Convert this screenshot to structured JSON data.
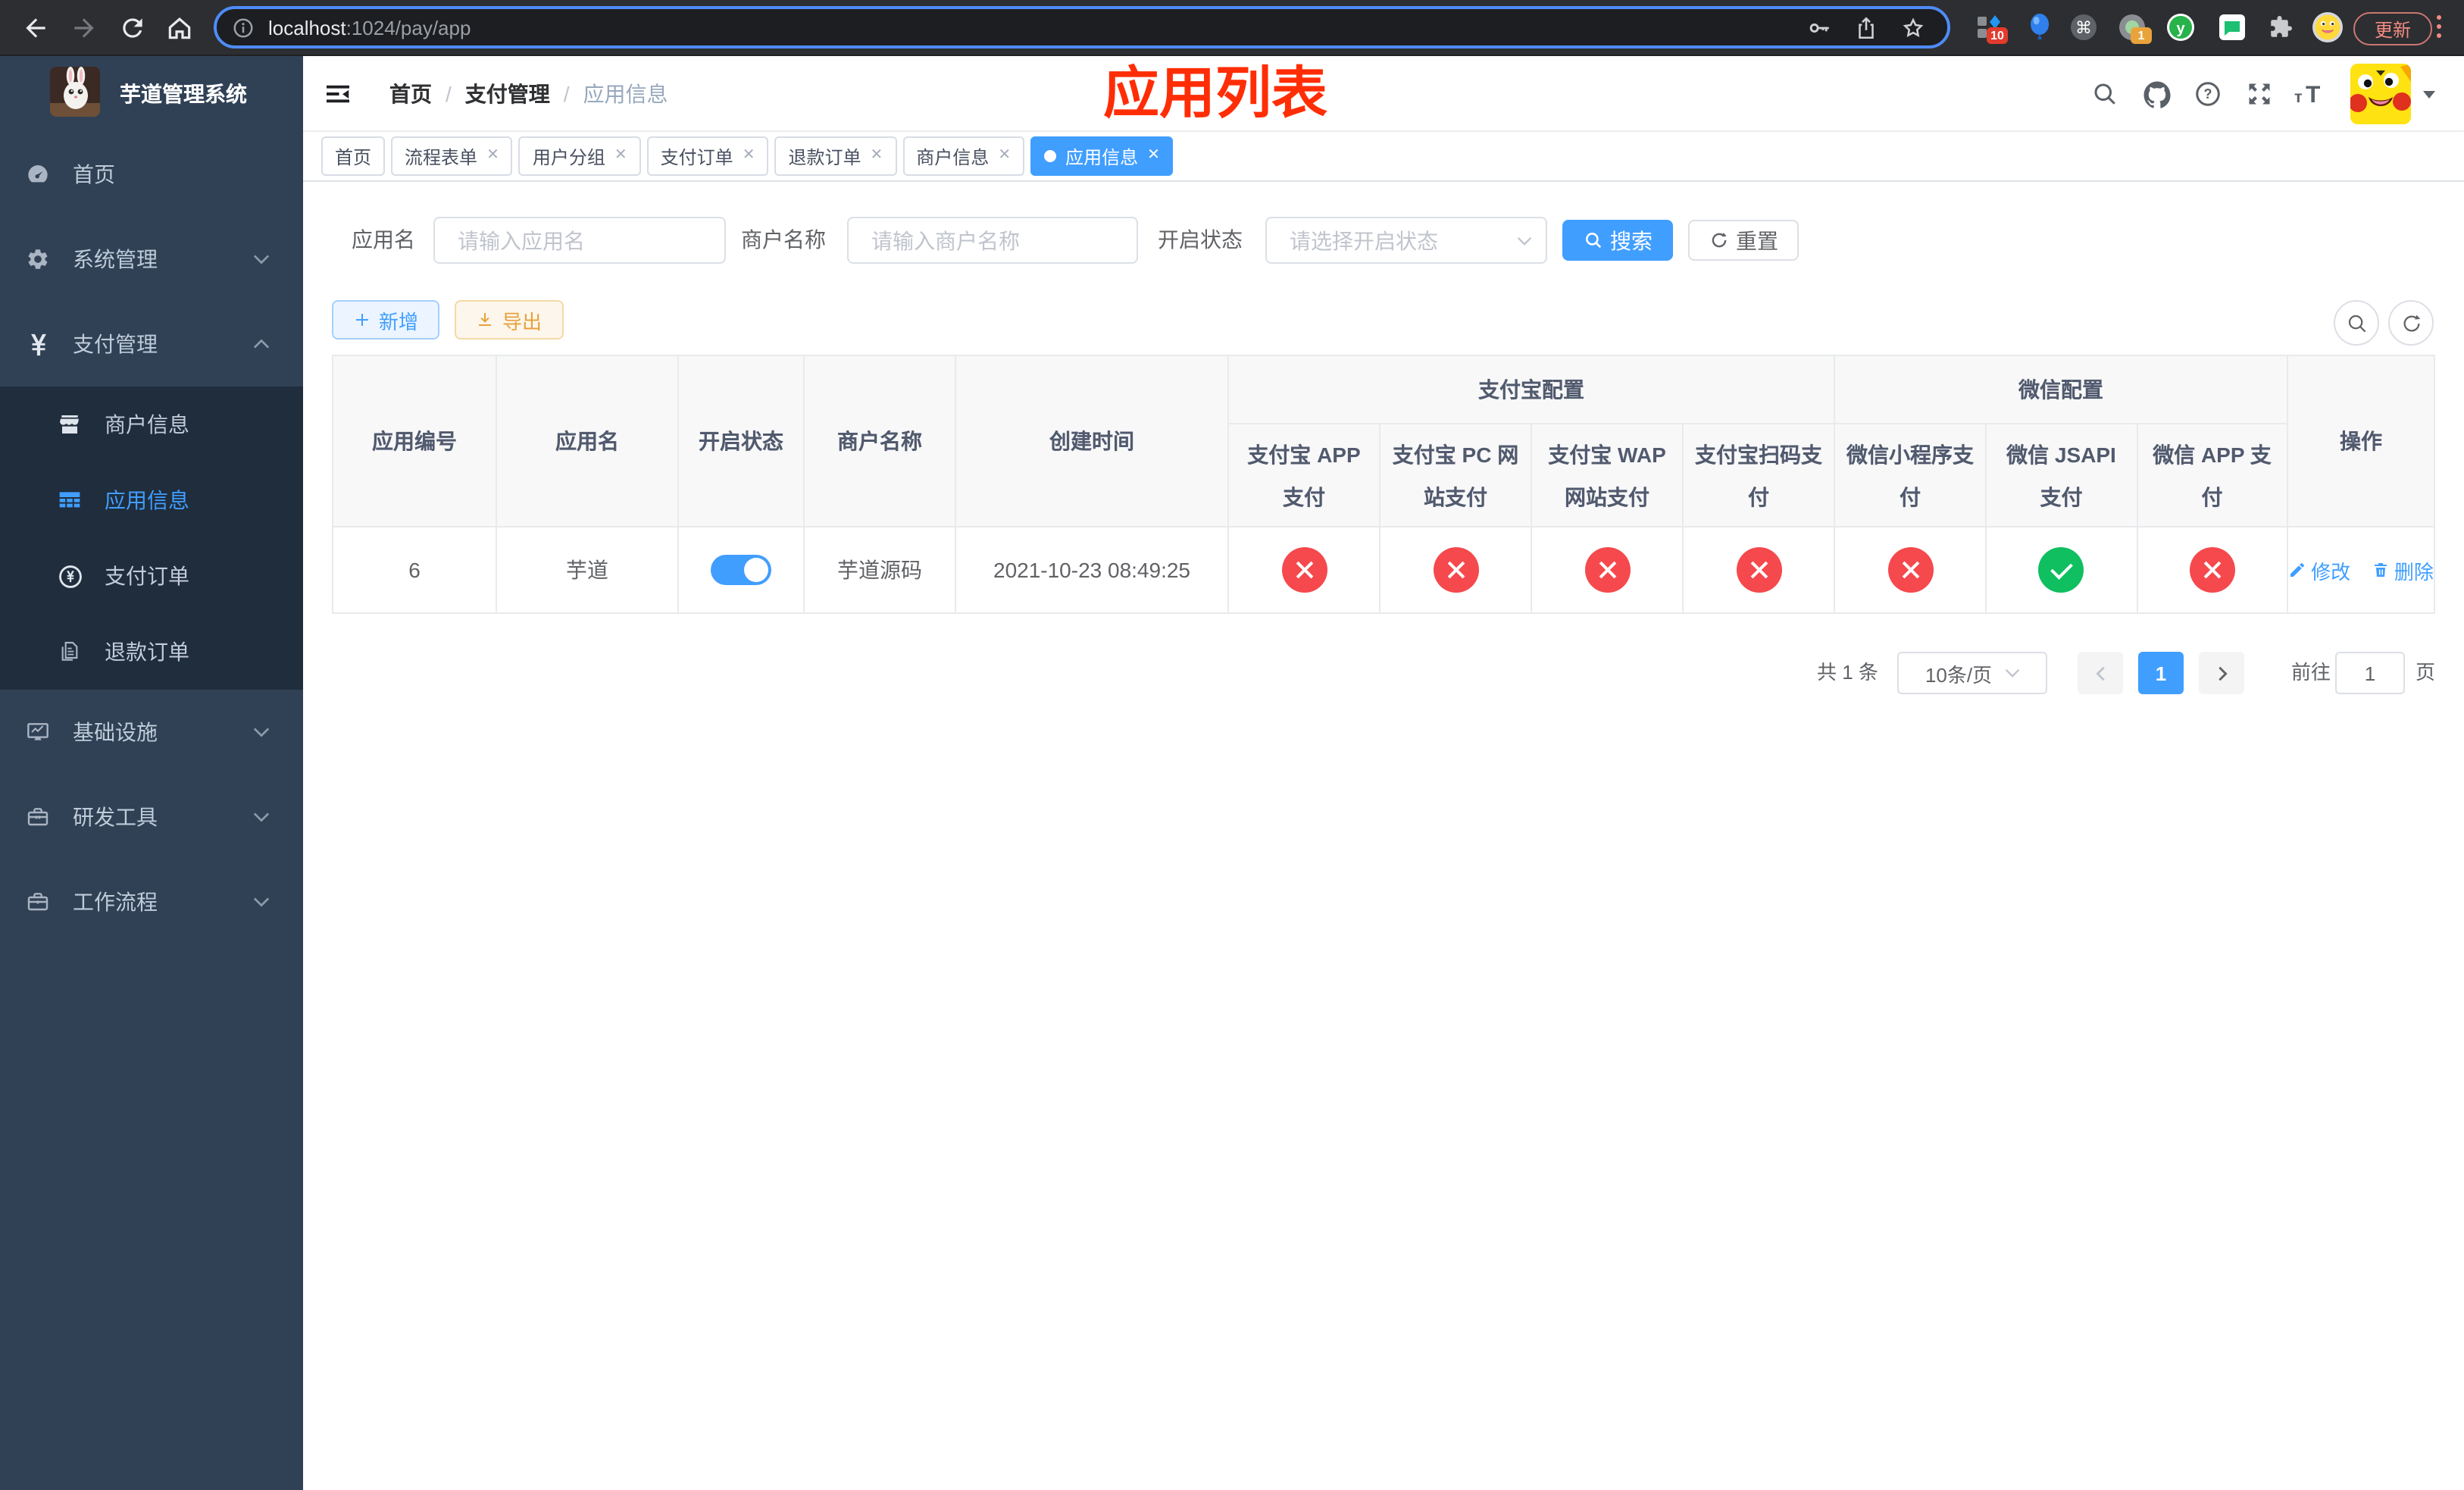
{
  "browser": {
    "url_host": "localhost",
    "url_path": ":1024/pay/app",
    "update_label": "更新",
    "ext_badge_1": "10",
    "ext_badge_2": "1"
  },
  "sidebar": {
    "title": "芋道管理系统",
    "menu": [
      {
        "label": "首页"
      },
      {
        "label": "系统管理"
      },
      {
        "label": "支付管理"
      },
      {
        "label": "基础设施"
      },
      {
        "label": "研发工具"
      },
      {
        "label": "工作流程"
      }
    ],
    "submenu": [
      {
        "label": "商户信息"
      },
      {
        "label": "应用信息"
      },
      {
        "label": "支付订单"
      },
      {
        "label": "退款订单"
      }
    ]
  },
  "header": {
    "breadcrumb": [
      "首页",
      "支付管理",
      "应用信息"
    ],
    "overlay_title": "应用列表"
  },
  "tabs": [
    {
      "label": "首页"
    },
    {
      "label": "流程表单"
    },
    {
      "label": "用户分组"
    },
    {
      "label": "支付订单"
    },
    {
      "label": "退款订单"
    },
    {
      "label": "商户信息"
    },
    {
      "label": "应用信息"
    }
  ],
  "filter": {
    "name_label": "应用名",
    "name_placeholder": "请输入应用名",
    "merchant_label": "商户名称",
    "merchant_placeholder": "请输入商户名称",
    "status_label": "开启状态",
    "status_placeholder": "请选择开启状态",
    "search_label": "搜索",
    "reset_label": "重置"
  },
  "toolbar": {
    "add_label": "新增",
    "export_label": "导出"
  },
  "table": {
    "headers": {
      "id": "应用编号",
      "name": "应用名",
      "status": "开启状态",
      "merchant": "商户名称",
      "created": "创建时间",
      "alipay_group": "支付宝配置",
      "wechat_group": "微信配置",
      "ops": "操作"
    },
    "sub_headers": [
      "支付宝 APP 支付",
      "支付宝 PC 网站支付",
      "支付宝 WAP 网站支付",
      "支付宝扫码支付",
      "微信小程序支付",
      "微信 JSAPI 支付",
      "微信 APP 支付"
    ],
    "row": {
      "id": "6",
      "name": "芋道",
      "enabled": true,
      "merchant": "芋道源码",
      "created": "2021-10-23 08:49:25",
      "configs": [
        "no",
        "no",
        "no",
        "no",
        "no",
        "yes",
        "no"
      ],
      "edit_label": "修改",
      "delete_label": "删除"
    }
  },
  "pagination": {
    "total": "共 1 条",
    "per_page": "10条/页",
    "page": "1",
    "goto_label": "前往",
    "goto_value": "1",
    "page_suffix": "页"
  }
}
